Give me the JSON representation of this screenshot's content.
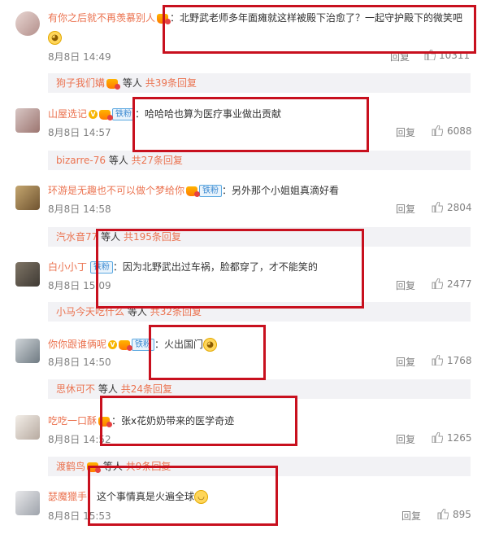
{
  "comments": [
    {
      "username": "有你之后就不再羡慕别人",
      "text": "北野武老师多年面瘫就这样被殿下治愈了？一起守护殿下的微笑吧",
      "emoji": "smile-cat-emoji",
      "date": "8月8日 14:49",
      "reply_label": "回复",
      "likes": "10311",
      "sub": {
        "name": "狗子我们媾",
        "etc": "等人",
        "count": "共39条回复"
      }
    },
    {
      "username": "山屋选记",
      "fan_badge": "铁粉",
      "text": "哈哈哈也算为医疗事业做出贡献",
      "date": "8月8日 14:57",
      "reply_label": "回复",
      "likes": "6088",
      "sub": {
        "name": "bizarre-76",
        "etc": "等人",
        "count": "共27条回复"
      }
    },
    {
      "username": "环游是无趣也不可以做个梦给你",
      "fan_badge": "铁粉",
      "text": "另外那个小姐姐真滴好看",
      "date": "8月8日 14:58",
      "reply_label": "回复",
      "likes": "2804",
      "sub": {
        "name": "汽水音77",
        "etc": "等人",
        "count": "共195条回复"
      }
    },
    {
      "username": "白小小丁",
      "fan_badge": "铁粉",
      "text": "因为北野武出过车祸，脸都穿了，才不能笑的",
      "date": "8月8日 15:09",
      "reply_label": "回复",
      "likes": "2477",
      "sub": {
        "name": "小马今天吃什么",
        "etc": "等人",
        "count": "共32条回复"
      }
    },
    {
      "username": "你你跟谁俩呢",
      "fan_badge": "铁粉",
      "text": "火出国门",
      "emoji": "smile-cat-emoji",
      "date": "8月8日 14:50",
      "reply_label": "回复",
      "likes": "1768",
      "sub": {
        "name": "思休可不",
        "etc": "等人",
        "count": "共24条回复"
      }
    },
    {
      "username": "吃吃一口酥",
      "text": "张x花奶奶带来的医学奇迹",
      "date": "8月8日 14:52",
      "reply_label": "回复",
      "likes": "1265",
      "sub": {
        "name": "渡鹤鸟",
        "etc": "等人",
        "count": "共9条回复"
      }
    },
    {
      "username": "瑟魔獵手",
      "text": "这个事情真是火遍全球",
      "emoji": "laugh-emoji",
      "date": "8月8日 15:53",
      "reply_label": "回复",
      "likes": "895"
    }
  ],
  "colors": {
    "username": "#eb7350",
    "highlight_box": "#c8101e",
    "meta": "#808080"
  }
}
